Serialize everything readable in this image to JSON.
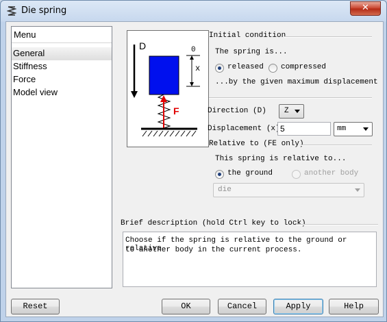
{
  "window": {
    "title": "Die spring",
    "close_label": "✕"
  },
  "menu": {
    "header": "Menu",
    "items": [
      {
        "label": "General",
        "selected": true
      },
      {
        "label": "Stiffness",
        "selected": false
      },
      {
        "label": "Force",
        "selected": false
      },
      {
        "label": "Model view",
        "selected": false
      }
    ]
  },
  "diagram": {
    "label_d": "D",
    "label_zero": "0",
    "label_x": "x",
    "label_f": "F"
  },
  "initial_condition": {
    "group_label": "Initial condition",
    "spring_is_text": "The spring is...",
    "options": [
      {
        "label": "released",
        "checked": true
      },
      {
        "label": "compressed",
        "checked": false
      }
    ],
    "by_text": "...by the given maximum displacement"
  },
  "direction": {
    "label": "Direction (D)",
    "value": "Z"
  },
  "displacement": {
    "label": "Displacement (x)",
    "value": "5",
    "unit": "mm"
  },
  "relative_to": {
    "group_label": "Relative to (FE only)",
    "text": "This spring is relative to...",
    "options": [
      {
        "label": "the ground",
        "checked": true,
        "enabled": true
      },
      {
        "label": "another body",
        "checked": false,
        "enabled": false
      }
    ],
    "body_select": "die"
  },
  "brief": {
    "group_label": "Brief description (hold Ctrl key to lock)",
    "text_line1": "Choose if the spring is relative to the ground or relative",
    "text_line2": "to another body in the current process."
  },
  "buttons": {
    "reset": "Reset",
    "ok": "OK",
    "cancel": "Cancel",
    "apply": "Apply",
    "help": "Help"
  },
  "colors": {
    "block": "#0010ee",
    "arrow": "#e00000",
    "titlebar": "#c7d8ee",
    "close": "#c8412b"
  }
}
